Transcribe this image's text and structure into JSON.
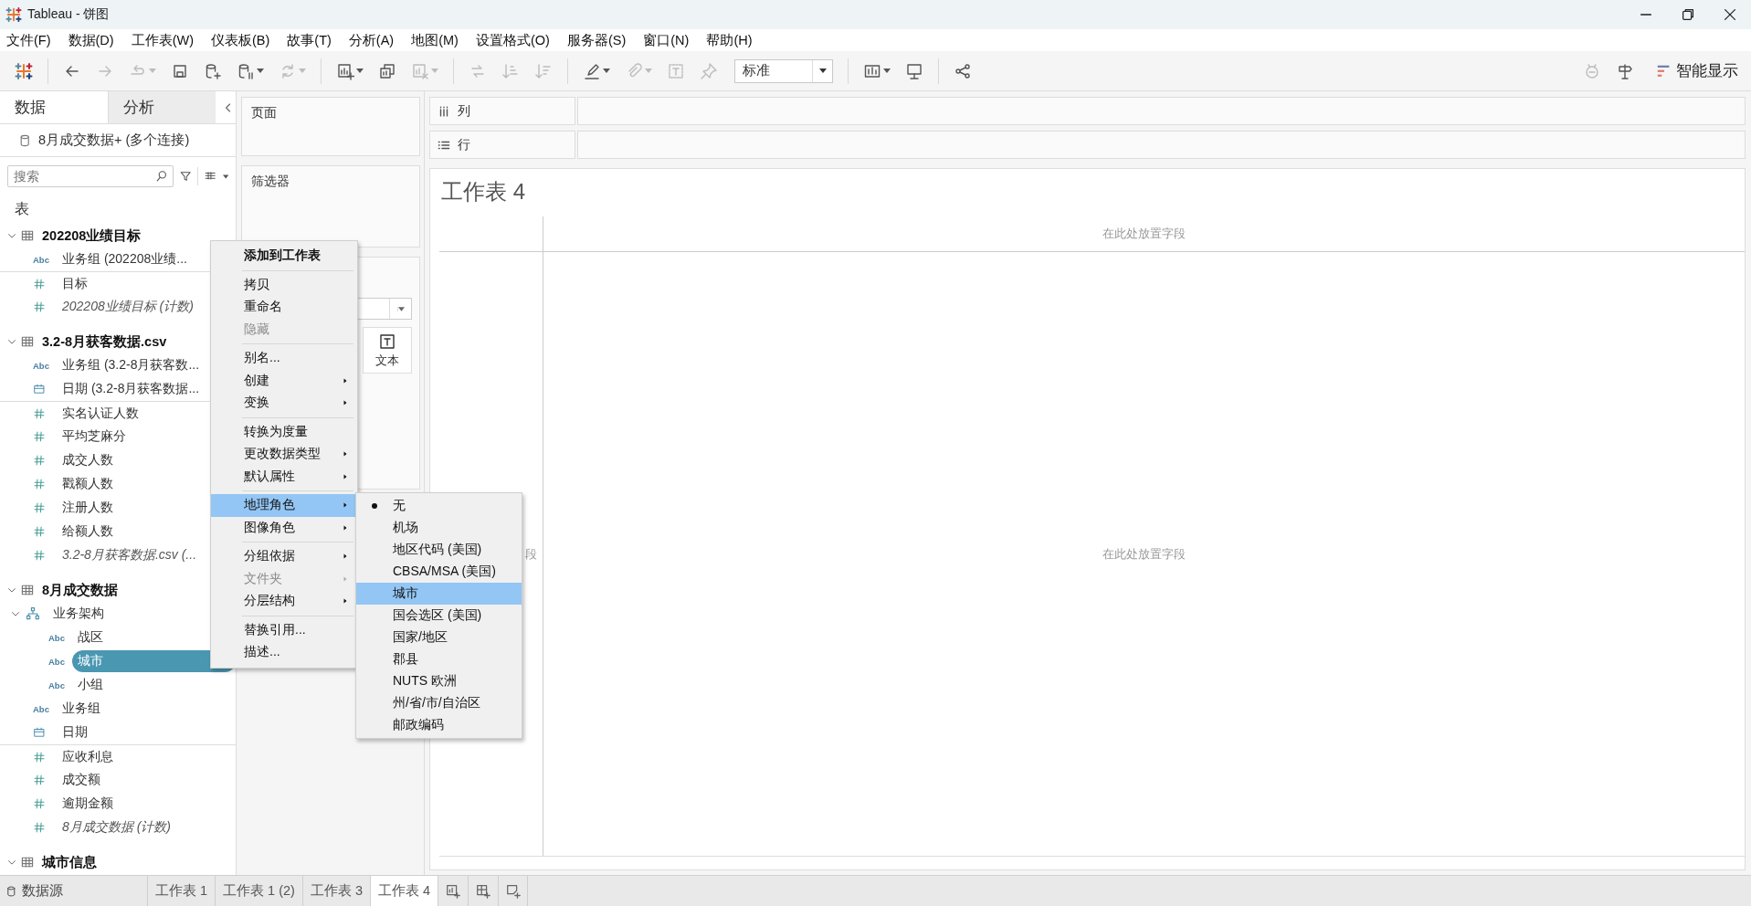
{
  "window": {
    "title": "Tableau - 饼图"
  },
  "menu_bar": [
    "文件(F)",
    "数据(D)",
    "工作表(W)",
    "仪表板(B)",
    "故事(T)",
    "分析(A)",
    "地图(M)",
    "设置格式(O)",
    "服务器(S)",
    "窗口(N)",
    "帮助(H)"
  ],
  "toolbar": {
    "buttons": [
      {
        "kind": "logo"
      },
      {
        "kind": "separator"
      },
      {
        "kind": "back",
        "disabled": false,
        "dropdown": false
      },
      {
        "kind": "forward",
        "disabled": true,
        "dropdown": false
      },
      {
        "kind": "redo",
        "disabled": true,
        "dropdown": true
      },
      {
        "kind": "save",
        "disabled": false,
        "dropdown": false
      },
      {
        "kind": "new-datasource",
        "disabled": false,
        "dropdown": false
      },
      {
        "kind": "pause",
        "disabled": false,
        "dropdown": true
      },
      {
        "kind": "refresh",
        "disabled": true,
        "dropdown": true
      },
      {
        "kind": "separator"
      },
      {
        "kind": "new-sheet",
        "disabled": false,
        "dropdown": true
      },
      {
        "kind": "duplicate",
        "disabled": false,
        "dropdown": false
      },
      {
        "kind": "clear",
        "disabled": true,
        "dropdown": true
      },
      {
        "kind": "separator"
      },
      {
        "kind": "swap",
        "disabled": true,
        "dropdown": false
      },
      {
        "kind": "sort-asc",
        "disabled": true,
        "dropdown": false
      },
      {
        "kind": "sort-desc",
        "disabled": true,
        "dropdown": false
      },
      {
        "kind": "separator"
      },
      {
        "kind": "highlight",
        "disabled": false,
        "dropdown": true
      },
      {
        "kind": "annotate",
        "disabled": true,
        "dropdown": true
      },
      {
        "kind": "label",
        "disabled": true,
        "dropdown": false
      },
      {
        "kind": "pin",
        "disabled": true,
        "dropdown": false
      },
      {
        "kind": "fit",
        "value": "标准"
      },
      {
        "kind": "separator"
      },
      {
        "kind": "show-me-cards",
        "disabled": false,
        "dropdown": true
      },
      {
        "kind": "presentation",
        "disabled": false,
        "dropdown": false
      },
      {
        "kind": "separator"
      },
      {
        "kind": "share",
        "disabled": false,
        "dropdown": false
      }
    ],
    "right": [
      {
        "kind": "ask-data",
        "disabled": true
      },
      {
        "kind": "signpost",
        "disabled": false
      }
    ],
    "show_me": "智能显示"
  },
  "data_pane": {
    "tabs": [
      {
        "label": "数据",
        "selected": true
      },
      {
        "label": "分析",
        "selected": false
      }
    ],
    "data_source": "8月成交数据+ (多个连接)",
    "search": {
      "placeholder": "搜索"
    },
    "section_title": "表",
    "tables": [
      {
        "name": "202208业绩目标",
        "expanded": true,
        "fields": [
          {
            "name": "业务组 (202208业绩...",
            "kind": "string",
            "badge": "Abc",
            "selected": false
          },
          {
            "name": "目标",
            "kind": "number",
            "selected": false
          },
          {
            "name": "202208业绩目标 (计数)",
            "kind": "count",
            "selected": false
          }
        ]
      },
      {
        "name": "3.2-8月获客数据.csv",
        "expanded": true,
        "fields": [
          {
            "name": "业务组 (3.2-8月获客数...",
            "kind": "string",
            "badge": "Abc",
            "selected": false
          },
          {
            "name": "日期 (3.2-8月获客数据...",
            "kind": "date",
            "selected": false
          },
          {
            "name": "实名认证人数",
            "kind": "number",
            "selected": false
          },
          {
            "name": "平均芝麻分",
            "kind": "number",
            "selected": false
          },
          {
            "name": "成交人数",
            "kind": "number",
            "selected": false
          },
          {
            "name": "戳额人数",
            "kind": "number",
            "selected": false
          },
          {
            "name": "注册人数",
            "kind": "number",
            "selected": false
          },
          {
            "name": "给额人数",
            "kind": "number",
            "selected": false
          },
          {
            "name": "3.2-8月获客数据.csv (...",
            "kind": "count",
            "selected": false
          }
        ]
      },
      {
        "name": "8月成交数据",
        "expanded": true,
        "fields": [
          {
            "name": "业务架构",
            "kind": "hierarchy",
            "expanded": true,
            "selected": false,
            "children": [
              {
                "name": "战区",
                "kind": "string",
                "badge": "Abc",
                "selected": false
              },
              {
                "name": "城市",
                "kind": "string",
                "badge": "Abc",
                "selected": true
              },
              {
                "name": "小组",
                "kind": "string",
                "badge": "Abc",
                "selected": false
              }
            ]
          },
          {
            "name": "业务组",
            "kind": "string",
            "badge": "Abc",
            "selected": false
          },
          {
            "name": "日期",
            "kind": "date",
            "selected": false
          },
          {
            "name": "应收利息",
            "kind": "number",
            "selected": false
          },
          {
            "name": "成交额",
            "kind": "number",
            "selected": false
          },
          {
            "name": "逾期金额",
            "kind": "number",
            "selected": false
          },
          {
            "name": "8月成交数据 (计数)",
            "kind": "count",
            "selected": false
          }
        ]
      },
      {
        "name": "城市信息",
        "expanded": true
      }
    ]
  },
  "shelves": {
    "pages": "页面",
    "filters": "筛选器",
    "marks": {
      "text_button": "文本"
    }
  },
  "view": {
    "columns_label": "列",
    "rows_label": "行",
    "title": "工作表 4",
    "column_drop": "在此处放置字段",
    "row_drop": "段",
    "body_drop": "在此处放置字段"
  },
  "context_menu": {
    "items": [
      {
        "kind": "default",
        "label": "添加到工作表",
        "disabled": false,
        "submenu": false,
        "highlighted": false
      },
      {
        "kind": "separator"
      },
      {
        "kind": "item",
        "label": "拷贝",
        "disabled": false,
        "submenu": false,
        "highlighted": false
      },
      {
        "kind": "item",
        "label": "重命名",
        "disabled": false,
        "submenu": false,
        "highlighted": false
      },
      {
        "kind": "item",
        "label": "隐藏",
        "disabled": true,
        "submenu": false,
        "highlighted": false
      },
      {
        "kind": "separator"
      },
      {
        "kind": "item",
        "label": "别名...",
        "disabled": false,
        "submenu": false,
        "highlighted": false
      },
      {
        "kind": "item",
        "label": "创建",
        "disabled": false,
        "submenu": true,
        "highlighted": false
      },
      {
        "kind": "item",
        "label": "变换",
        "disabled": false,
        "submenu": true,
        "highlighted": false
      },
      {
        "kind": "separator"
      },
      {
        "kind": "item",
        "label": "转换为度量",
        "disabled": false,
        "submenu": false,
        "highlighted": false
      },
      {
        "kind": "item",
        "label": "更改数据类型",
        "disabled": false,
        "submenu": true,
        "highlighted": false
      },
      {
        "kind": "item",
        "label": "默认属性",
        "disabled": false,
        "submenu": true,
        "highlighted": false
      },
      {
        "kind": "separator"
      },
      {
        "kind": "item",
        "label": "地理角色",
        "disabled": false,
        "submenu": true,
        "highlighted": true
      },
      {
        "kind": "item",
        "label": "图像角色",
        "disabled": false,
        "submenu": true,
        "highlighted": false
      },
      {
        "kind": "separator"
      },
      {
        "kind": "item",
        "label": "分组依据",
        "disabled": false,
        "submenu": true,
        "highlighted": false
      },
      {
        "kind": "item",
        "label": "文件夹",
        "disabled": true,
        "submenu": true,
        "highlighted": false
      },
      {
        "kind": "item",
        "label": "分层结构",
        "disabled": false,
        "submenu": true,
        "highlighted": false
      },
      {
        "kind": "separator"
      },
      {
        "kind": "item",
        "label": "替换引用...",
        "disabled": false,
        "submenu": false,
        "highlighted": false
      },
      {
        "kind": "item",
        "label": "描述...",
        "disabled": false,
        "submenu": false,
        "highlighted": false
      }
    ]
  },
  "submenu": {
    "items": [
      {
        "label": "无",
        "checked": true,
        "highlighted": false
      },
      {
        "label": "机场",
        "checked": false,
        "highlighted": false
      },
      {
        "label": "地区代码 (美国)",
        "checked": false,
        "highlighted": false
      },
      {
        "label": "CBSA/MSA (美国)",
        "checked": false,
        "highlighted": false
      },
      {
        "label": "城市",
        "checked": false,
        "highlighted": true
      },
      {
        "label": "国会选区 (美国)",
        "checked": false,
        "highlighted": false
      },
      {
        "label": "国家/地区",
        "checked": false,
        "highlighted": false
      },
      {
        "label": "郡县",
        "checked": false,
        "highlighted": false
      },
      {
        "label": "NUTS 欧洲",
        "checked": false,
        "highlighted": false
      },
      {
        "label": "州/省/市/自治区",
        "checked": false,
        "highlighted": false
      },
      {
        "label": "邮政编码",
        "checked": false,
        "highlighted": false
      }
    ]
  },
  "sheet_tabs": {
    "data_source": "数据源",
    "tabs": [
      {
        "label": "工作表 1",
        "selected": false
      },
      {
        "label": "工作表 1 (2)",
        "selected": false
      },
      {
        "label": "工作表 3",
        "selected": false
      },
      {
        "label": "工作表 4",
        "selected": true
      }
    ]
  }
}
